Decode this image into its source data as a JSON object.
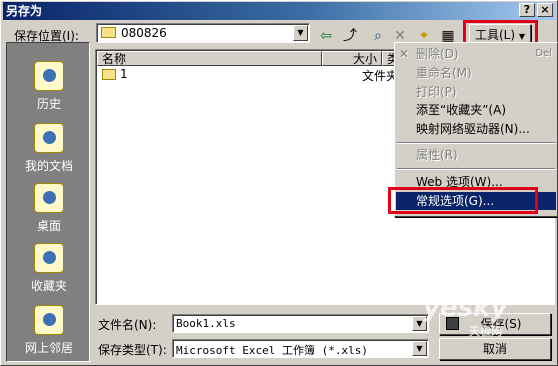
{
  "window": {
    "title": "另存为",
    "help": "?",
    "close": "×"
  },
  "save_in": {
    "label": "保存位置(I):",
    "value": "080826"
  },
  "tools_button": {
    "label": "工具(L)"
  },
  "places": [
    {
      "label": "历史"
    },
    {
      "label": "我的文档"
    },
    {
      "label": "桌面"
    },
    {
      "label": "收藏夹"
    },
    {
      "label": "网上邻居"
    }
  ],
  "columns": [
    "名称",
    "大小",
    "类型"
  ],
  "files": [
    {
      "name": "1",
      "type": "文件夹"
    }
  ],
  "tools_menu": {
    "items": [
      {
        "label": "删除(D)",
        "shortcut": "Del",
        "disabled": true
      },
      {
        "label": "重命名(M)",
        "disabled": true
      },
      {
        "label": "打印(P)",
        "disabled": true
      },
      {
        "label": "添至“收藏夹”(A)"
      },
      {
        "label": "映射网络驱动器(N)..."
      },
      {
        "label": "属性(R)",
        "disabled": true
      },
      {
        "label": "Web 选项(W)..."
      },
      {
        "label": "常规选项(G)...",
        "selected": true
      }
    ]
  },
  "filename": {
    "label": "文件名(N):",
    "value": "Book1.xls"
  },
  "filetype": {
    "label": "保存类型(T):",
    "value": "Microsoft Excel 工作簿 (*.xls)"
  },
  "buttons": {
    "save": "保存(S)",
    "cancel": "取消"
  },
  "watermark": {
    "main": "yesky",
    "sub": "天极网"
  },
  "colors": {
    "highlight_box": "#e0001a",
    "selection": "#0a246a"
  }
}
